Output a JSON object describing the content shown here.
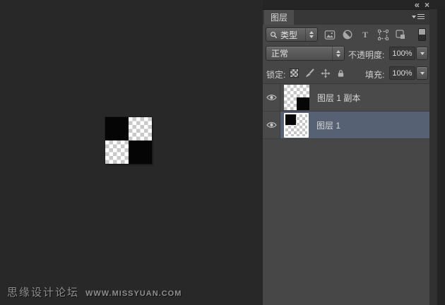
{
  "window": {
    "collapse_icon": "«",
    "close_icon": "×"
  },
  "panel": {
    "tab_label": "图层",
    "filter_row": {
      "kind_label": "类型",
      "type_filter_glyph": "T",
      "filter_icon_names": [
        "pixel-layer-filter",
        "adjustment-layer-filter",
        "type-layer-filter",
        "shape-layer-filter",
        "smart-object-filter"
      ]
    },
    "blend_row": {
      "blend_mode": "正常",
      "opacity_label": "不透明度:",
      "opacity_value": "100%"
    },
    "lock_row": {
      "lock_label": "锁定:",
      "fill_label": "填充:",
      "fill_value": "100%"
    },
    "layers": [
      {
        "name": "图层 1 副本",
        "visible": true,
        "selected": false,
        "thumb": "black-bottom-right"
      },
      {
        "name": "图层 1",
        "visible": true,
        "selected": true,
        "thumb": "black-top-left"
      }
    ]
  },
  "watermark": {
    "site": "思缘设计论坛",
    "url": "WWW.MISSYUAN.COM"
  },
  "colors": {
    "canvas_bg": "#282828",
    "panel_bg": "#464646",
    "selected_row": "#566173",
    "highlight_text": "#d8d8d8"
  }
}
